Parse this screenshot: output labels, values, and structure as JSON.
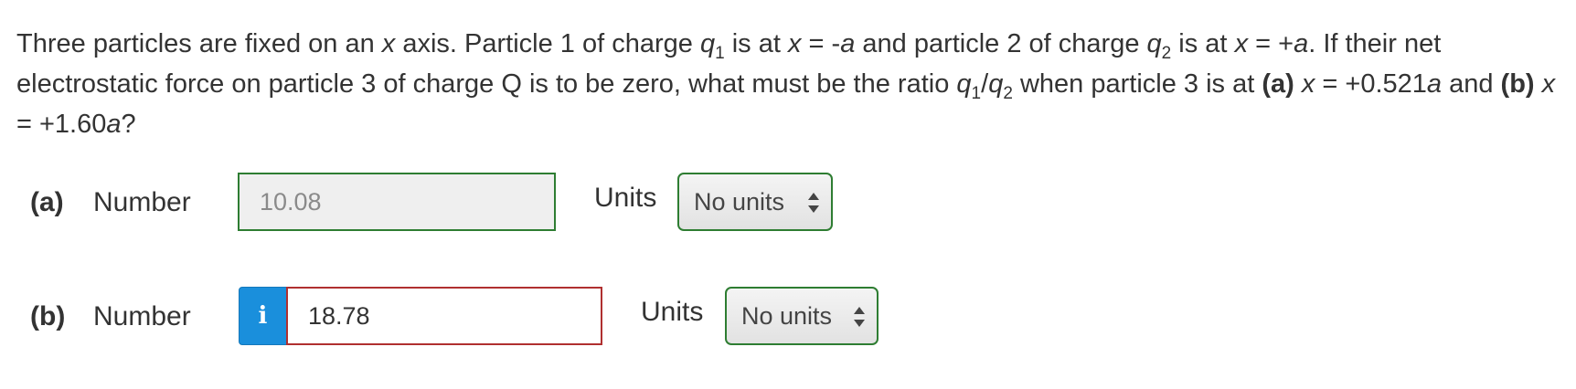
{
  "question": {
    "t1": "Three particles are fixed on an ",
    "x1": "x",
    "t2": " axis. Particle 1 of charge ",
    "q1a": "q",
    "q1a_sub": "1",
    "t3": " is at ",
    "x2": "x",
    "t4": " = -",
    "a1": "a",
    "t5": " and particle 2 of charge ",
    "q2a": "q",
    "q2a_sub": "2",
    "t6": " is at ",
    "x3": "x",
    "t7": " = +",
    "a2": "a",
    "t8": ". If their net electrostatic force on particle 3 of charge Q is to be zero, what must be the ratio ",
    "q1b": "q",
    "q1b_sub": "1",
    "slash": "/",
    "q2b": "q",
    "q2b_sub": "2",
    "t9": " when particle 3 is at ",
    "pa": "(a)",
    "t10": " ",
    "x4": "x",
    "t11": " = +0.521",
    "a3": "a",
    "t12": " and ",
    "pb": "(b)",
    "t13": " ",
    "x5": "x",
    "t14": " = +1.60",
    "a4": "a",
    "t15": "?"
  },
  "part_a": {
    "label": "(a)",
    "number_label": "Number",
    "value": "10.08",
    "units_label": "Units",
    "units_value": "No units"
  },
  "part_b": {
    "label": "(b)",
    "number_label": "Number",
    "info_glyph": "i",
    "value": "18.78",
    "units_label": "Units",
    "units_value": "No units"
  },
  "colors": {
    "correct_border": "#2e7d32",
    "incorrect_border": "#b03030",
    "info_button": "#1a8fdc"
  },
  "icons": {
    "info": "info-icon",
    "select_arrows": "up-down-arrows-icon"
  }
}
